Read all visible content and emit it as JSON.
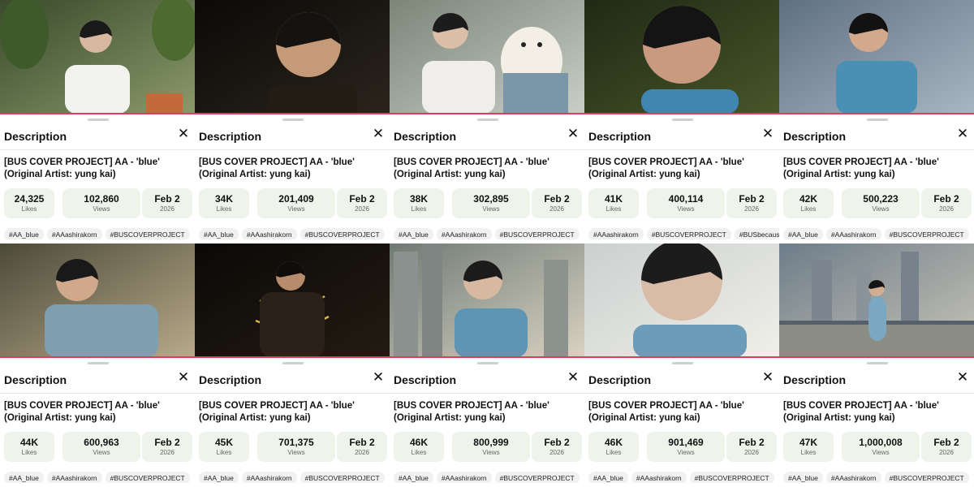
{
  "colors": {
    "progress": "#e33b5c",
    "stat_bg": "#eef4ea"
  },
  "panels": [
    {
      "thumb": "man in white shirt on terrace",
      "progress": 1.0,
      "heading": "Description",
      "title": "[BUS COVER PROJECT] AA - 'blue' (Original Artist: yung kai)",
      "likes": "24,325",
      "likes_label": "Likes",
      "views": "102,860",
      "views_label": "Views",
      "date": "Feb 2",
      "year": "2026",
      "tags": [
        "#AA_blue",
        "#AAashirakorn",
        "#BUSCOVERPROJECT"
      ]
    },
    {
      "thumb": "close-up face with warm lights",
      "progress": 1.0,
      "heading": "Description",
      "title": "[BUS COVER PROJECT] AA - 'blue' (Original Artist: yung kai)",
      "likes": "34K",
      "likes_label": "Likes",
      "views": "201,409",
      "views_label": "Views",
      "date": "Feb 2",
      "year": "2026",
      "tags": [
        "#AA_blue",
        "#AAashirakorn",
        "#BUSCOVERPROJECT"
      ]
    },
    {
      "thumb": "man holding a small white dog",
      "progress": 1.0,
      "heading": "Description",
      "title": "[BUS COVER PROJECT] AA - 'blue' (Original Artist: yung kai)",
      "likes": "38K",
      "likes_label": "Likes",
      "views": "302,895",
      "views_label": "Views",
      "date": "Feb 2",
      "year": "2026",
      "tags": [
        "#AA_blue",
        "#AAashirakorn",
        "#BUSCOVERPROJECT"
      ]
    },
    {
      "thumb": "smiling face close-up in blue sweater",
      "progress": 1.0,
      "heading": "Description",
      "title": "[BUS COVER PROJECT] AA - 'blue' (Original Artist: yung kai)",
      "likes": "41K",
      "likes_label": "Likes",
      "views": "400,114",
      "views_label": "Views",
      "date": "Feb 2",
      "year": "2026",
      "tags": [
        "#AAashirakorn",
        "#BUSCOVERPROJECT",
        "#BUSbecause"
      ]
    },
    {
      "thumb": "smiling man outdoors at dusk",
      "progress": 1.0,
      "heading": "Description",
      "title": "[BUS COVER PROJECT] AA - 'blue' (Original Artist: yung kai)",
      "likes": "42K",
      "likes_label": "Likes",
      "views": "500,223",
      "views_label": "Views",
      "date": "Feb 2",
      "year": "2026",
      "tags": [
        "#AA_blue",
        "#AAashirakorn",
        "#BUSCOVERPROJECT"
      ]
    },
    {
      "thumb": "man in blue sweater in field",
      "progress": 1.0,
      "heading": "Description",
      "title": "[BUS COVER PROJECT] AA - 'blue' (Original Artist: yung kai)",
      "likes": "44K",
      "likes_label": "Likes",
      "views": "600,963",
      "views_label": "Views",
      "date": "Feb 2",
      "year": "2026",
      "tags": [
        "#AA_blue",
        "#AAashirakorn",
        "#BUSCOVERPROJECT"
      ]
    },
    {
      "thumb": "figure wrapped in fairy lights",
      "progress": 1.0,
      "heading": "Description",
      "title": "[BUS COVER PROJECT] AA - 'blue' (Original Artist: yung kai)",
      "likes": "45K",
      "likes_label": "Likes",
      "views": "701,375",
      "views_label": "Views",
      "date": "Feb 2",
      "year": "2026",
      "tags": [
        "#AA_blue",
        "#AAashirakorn",
        "#BUSCOVERPROJECT"
      ]
    },
    {
      "thumb": "man with city skyline behind",
      "progress": 1.0,
      "heading": "Description",
      "title": "[BUS COVER PROJECT] AA - 'blue' (Original Artist: yung kai)",
      "likes": "46K",
      "likes_label": "Likes",
      "views": "800,999",
      "views_label": "Views",
      "date": "Feb 2",
      "year": "2026",
      "tags": [
        "#AA_blue",
        "#AAashirakorn",
        "#BUSCOVERPROJECT"
      ]
    },
    {
      "thumb": "face looking down close-up",
      "progress": 1.0,
      "heading": "Description",
      "title": "[BUS COVER PROJECT] AA - 'blue' (Original Artist: yung kai)",
      "likes": "46K",
      "likes_label": "Likes",
      "views": "901,469",
      "views_label": "Views",
      "date": "Feb 2",
      "year": "2026",
      "tags": [
        "#AA_blue",
        "#AAashirakorn",
        "#BUSCOVERPROJECT"
      ]
    },
    {
      "thumb": "man on bridge with city skyline",
      "progress": 1.0,
      "heading": "Description",
      "title": "[BUS COVER PROJECT] AA - 'blue' (Original Artist: yung kai)",
      "likes": "47K",
      "likes_label": "Likes",
      "views": "1,000,008",
      "views_label": "Views",
      "date": "Feb 2",
      "year": "2026",
      "tags": [
        "#AA_blue",
        "#AAashirakorn",
        "#BUSCOVERPROJECT"
      ]
    }
  ]
}
